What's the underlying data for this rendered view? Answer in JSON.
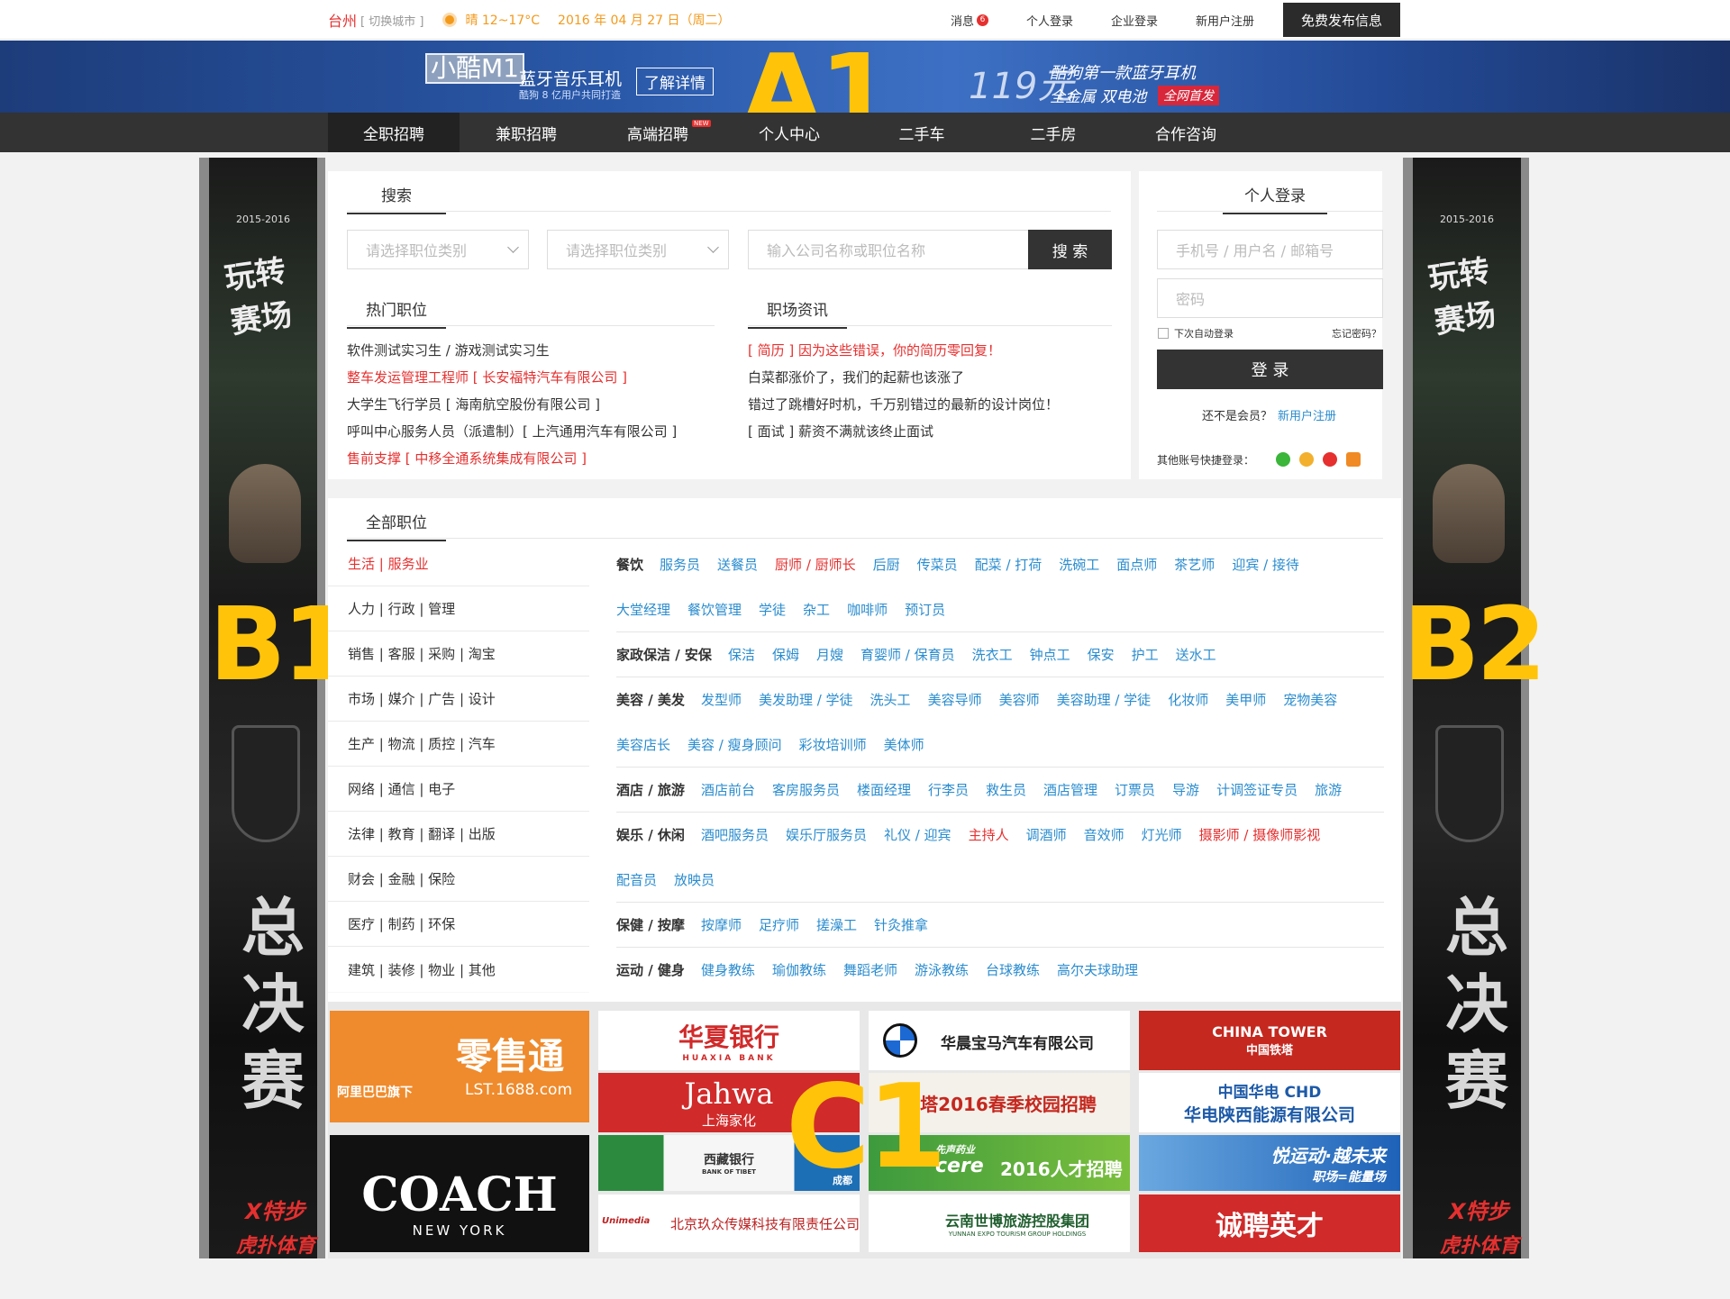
{
  "topbar": {
    "city": "台州",
    "switch_city": "[ 切换城市 ]",
    "weather": "晴  12~17°C",
    "date": "2016 年 04 月 27 日（周二）",
    "links": {
      "message": "消息",
      "message_count": "6",
      "personal_login": "个人登录",
      "company_login": "企业登录",
      "register": "新用户注册",
      "publish": "免费发布信息"
    }
  },
  "banner": {
    "product": "小酷M1",
    "headline": "蓝牙音乐耳机",
    "sub": "酷狗 8 亿用户共同打造",
    "cta": "了解详情",
    "price": "119元",
    "slogan1": "酷狗第一款蓝牙耳机",
    "slogan2": "全金属 双电池",
    "launch": "全网首发"
  },
  "labels": {
    "a1": "A1",
    "b1": "B1",
    "b2": "B2",
    "c1": "C1"
  },
  "nav": {
    "items": [
      "全职招聘",
      "兼职招聘",
      "高端招聘",
      "个人中心",
      "二手车",
      "二手房",
      "合作咨询"
    ],
    "new_badge": "NEW"
  },
  "sidead": {
    "year": "2015-2016",
    "brush": "玩转赛场",
    "final1": "总",
    "final2": "决",
    "final3": "赛",
    "xstep": "X特步",
    "hu": "虎扑体育"
  },
  "search": {
    "title": "搜索",
    "select1_placeholder": "请选择职位类别",
    "select2_placeholder": "请选择职位类别",
    "keyword_placeholder": "输入公司名称或职位名称",
    "button": "搜 索"
  },
  "hot_jobs": {
    "title": "热门职位",
    "items": [
      {
        "text": "软件测试实习生 / 游戏测试实习生",
        "hot": false
      },
      {
        "text": "整车发运管理工程师 [ 长安福特汽车有限公司 ]",
        "hot": true
      },
      {
        "text": "大学生飞行学员 [ 海南航空股份有限公司 ]",
        "hot": false
      },
      {
        "text": "呼叫中心服务人员（派遣制）[ 上汽通用汽车有限公司 ]",
        "hot": false
      },
      {
        "text": "售前支撑 [ 中移全通系统集成有限公司 ]",
        "hot": true
      }
    ]
  },
  "news": {
    "title": "职场资讯",
    "items": [
      {
        "text": "[ 简历 ] 因为这些错误，你的简历零回复！",
        "hot": true
      },
      {
        "text": "白菜都涨价了，我们的起薪也该涨了",
        "hot": false
      },
      {
        "text": "错过了跳槽好时机，千万别错过的最新的设计岗位！",
        "hot": false
      },
      {
        "text": "[ 面试 ] 薪资不满就该终止面试",
        "hot": false
      }
    ]
  },
  "login": {
    "title": "个人登录",
    "user_placeholder": "手机号 / 用户名 / 邮箱号",
    "pass_placeholder": "密码",
    "auto_login": "下次自动登录",
    "forgot": "忘记密码？",
    "button": "登 录",
    "not_member": "还不是会员？",
    "register": "新用户注册",
    "other": "其他账号快捷登录："
  },
  "categories": {
    "title": "全部职位",
    "left": [
      "生活 | 服务业",
      "人力 | 行政 | 管理",
      "销售 | 客服 | 采购 | 淘宝",
      "市场 | 媒介 | 广告 | 设计",
      "生产 | 物流 | 质控 | 汽车",
      "网络 | 通信 | 电子",
      "法律 | 教育 | 翻译 | 出版",
      "财会 | 金融 | 保险",
      "医疗 | 制药 | 环保",
      "建筑 | 装修 | 物业 | 其他"
    ],
    "rows": [
      {
        "head": "餐饮",
        "jobs": [
          "服务员",
          "送餐员",
          "厨师 / 厨师长",
          "后厨",
          "传菜员",
          "配菜 / 打荷",
          "洗碗工",
          "面点师",
          "茶艺师",
          "迎宾 / 接待"
        ],
        "red": [
          2
        ]
      },
      {
        "head": "",
        "jobs": [
          "大堂经理",
          "餐饮管理",
          "学徒",
          "杂工",
          "咖啡师",
          "预订员"
        ],
        "red": []
      },
      {
        "head": "家政保洁 / 安保",
        "jobs": [
          "保洁",
          "保姆",
          "月嫂",
          "育婴师 / 保育员",
          "洗衣工",
          "钟点工",
          "保安",
          "护工",
          "送水工"
        ],
        "red": []
      },
      {
        "head": "美容 / 美发",
        "jobs": [
          "发型师",
          "美发助理 / 学徒",
          "洗头工",
          "美容导师",
          "美容师",
          "美容助理 / 学徒",
          "化妆师",
          "美甲师",
          "宠物美容"
        ],
        "red": []
      },
      {
        "head": "",
        "jobs": [
          "美容店长",
          "美容 / 瘦身顾问",
          "彩妆培训师",
          "美体师"
        ],
        "red": []
      },
      {
        "head": "酒店 / 旅游",
        "jobs": [
          "酒店前台",
          "客房服务员",
          "楼面经理",
          "行李员",
          "救生员",
          "酒店管理",
          "订票员",
          "导游",
          "计调签证专员",
          "旅游"
        ],
        "red": []
      },
      {
        "head": "娱乐 / 休闲",
        "jobs": [
          "酒吧服务员",
          "娱乐厅服务员",
          "礼仪 / 迎宾",
          "主持人",
          "调酒师",
          "音效师",
          "灯光师",
          "摄影师 / 摄像师影视"
        ],
        "red": [
          3,
          7
        ]
      },
      {
        "head": "",
        "jobs": [
          "配音员",
          "放映员"
        ],
        "red": []
      },
      {
        "head": "保健 / 按摩",
        "jobs": [
          "按摩师",
          "足疗师",
          "搓澡工",
          "针灸推拿"
        ],
        "red": []
      },
      {
        "head": "运动 / 健身",
        "jobs": [
          "健身教练",
          "瑜伽教练",
          "舞蹈老师",
          "游泳教练",
          "台球教练",
          "高尔夫球助理"
        ],
        "red": []
      }
    ]
  },
  "logos": {
    "alibaba_top": "零售通",
    "alibaba_sub": "阿里巴巴旗下",
    "alibaba_url": "LST.1688.com",
    "coach": "COACH",
    "coach_sub": "NEW YORK",
    "huaxia": "华夏银行",
    "huaxia_en": "HUAXIA BANK",
    "jahwa": "Jahwa",
    "jahwa_cn": "上海家化",
    "tibet": "西藏银行",
    "tibet_en": "BANK OF TIBET",
    "tibet_city": "成都",
    "unimedia": "北京玖众传媒科技有限责任公司",
    "unimedia_en": "Unimedia",
    "bmw": "华晨宝马汽车有限公司",
    "tower_campus": "铁塔2016春季校园招聘",
    "xiansheng": "先声药业",
    "xiansheng_en": "cere",
    "xiansheng_job": "2016人才招聘",
    "yunnan": "云南世博旅游控股集团",
    "yunnan_en": "YUNNAN EXPO TOURISM GROUP HOLDINGS",
    "chinatower": "CHINA TOWER",
    "chinatower_cn": "中国铁塔",
    "chd": "中国华电  CHD",
    "chd_sub": "华电陕西能源有限公司",
    "sport": "悦运动·越未来",
    "sport_sub": "职场=能量场",
    "hire": "诚聘英才"
  },
  "colors": {
    "accent_red": "#e5302f",
    "link_blue": "#2a8ccf",
    "dark": "#333333",
    "weather_orange": "#f39a1c",
    "label_yellow": "#ffc40a"
  }
}
